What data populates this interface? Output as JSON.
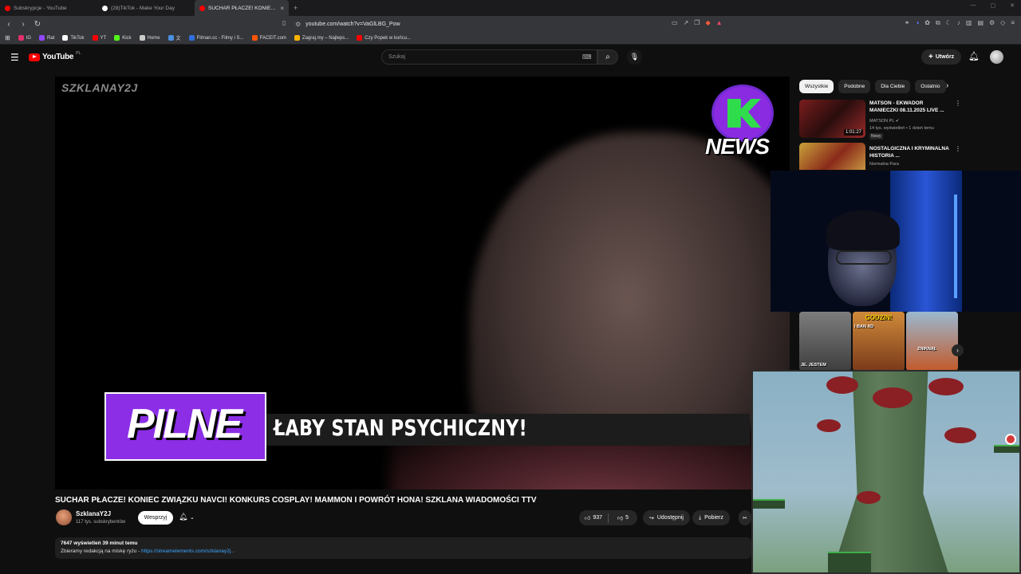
{
  "browser": {
    "tabs": [
      {
        "label": "Subskrypcje - YouTube",
        "color": "#ff0000",
        "active": false
      },
      {
        "label": "(28)TikTok - Make Your Day",
        "color": "#ffffff",
        "active": false
      },
      {
        "label": "SUCHAR PŁACZE! KONIEC ZW...",
        "color": "#ff0000",
        "active": true
      }
    ],
    "url": "youtube.com/watch?v=VaGlLBG_Pow",
    "bookmarks": [
      {
        "label": "IG",
        "color": "#e1306c"
      },
      {
        "label": "Rat",
        "color": "#9146ff"
      },
      {
        "label": "TikTok",
        "color": "#ffffff"
      },
      {
        "label": "YT",
        "color": "#ff0000"
      },
      {
        "label": "Kick",
        "color": "#53fc18"
      },
      {
        "label": "Home",
        "color": "#cccccc"
      },
      {
        "label": "Filman.cc - Filmy i S...",
        "color": "#2f6fdb"
      },
      {
        "label": "FACEIT.com",
        "color": "#ff5500"
      },
      {
        "label": "Zagraj.my – Najleps...",
        "color": "#ffb300"
      },
      {
        "label": "Czy Popek w końcu...",
        "color": "#ff0000"
      }
    ]
  },
  "youtube": {
    "country": "PL",
    "brand": "YouTube",
    "search_placeholder": "Szukaj",
    "create_label": "Utwórz"
  },
  "player": {
    "watermark": "SZKLANAY2J",
    "news_logo_text": "NEWS",
    "tag_text": "PILNE",
    "ticker_text": "ŁABY STAN PSYCHICZNY!"
  },
  "video": {
    "title": "SUCHAR PŁACZE! KONIEC ZWIĄZKU NAVCI! KONKURS COSPLAY! MAMMON I POWRÓT HONA! SZKLANA WIADOMOŚCI TTV",
    "channel": "SzklanaY2J",
    "subscribers": "117 tys. subskrybentów",
    "support_label": "Wesprzyj",
    "likes": "937",
    "dislikes": "5",
    "share_label": "Udostępnij",
    "download_label": "Pobierz",
    "views_time": "7647 wyświetleń  39 minut temu",
    "description": "Zbieramy redakcją na miskę ryżu - ",
    "description_link": "https://streamelements.com/szklanay2j..."
  },
  "sidebar": {
    "chips": [
      "Wszystkie",
      "Podobne",
      "Dla Ciebie",
      "Ostatnio"
    ],
    "recs": [
      {
        "title": "MATSON - EKWADOR MANIECZKI 08.11.2025 LIVE ...",
        "channel": "MATSON PL",
        "meta": "14 tys. wyświetleń • 1 dzień temu",
        "badge": "Nowy",
        "duration": "1:01:27"
      },
      {
        "title": "NOSTALGICZNA I KRYMINALNA HISTORIA ...",
        "channel": "Normalna Para",
        "meta": "",
        "badge": "",
        "duration": ""
      }
    ],
    "shorts": [
      {
        "top": "",
        "caption": "JE. JESTEM"
      },
      {
        "top": "GODZIN!",
        "caption": "I BAN XD"
      },
      {
        "top": "",
        "caption": "ZNIKNĄŁ"
      }
    ]
  }
}
